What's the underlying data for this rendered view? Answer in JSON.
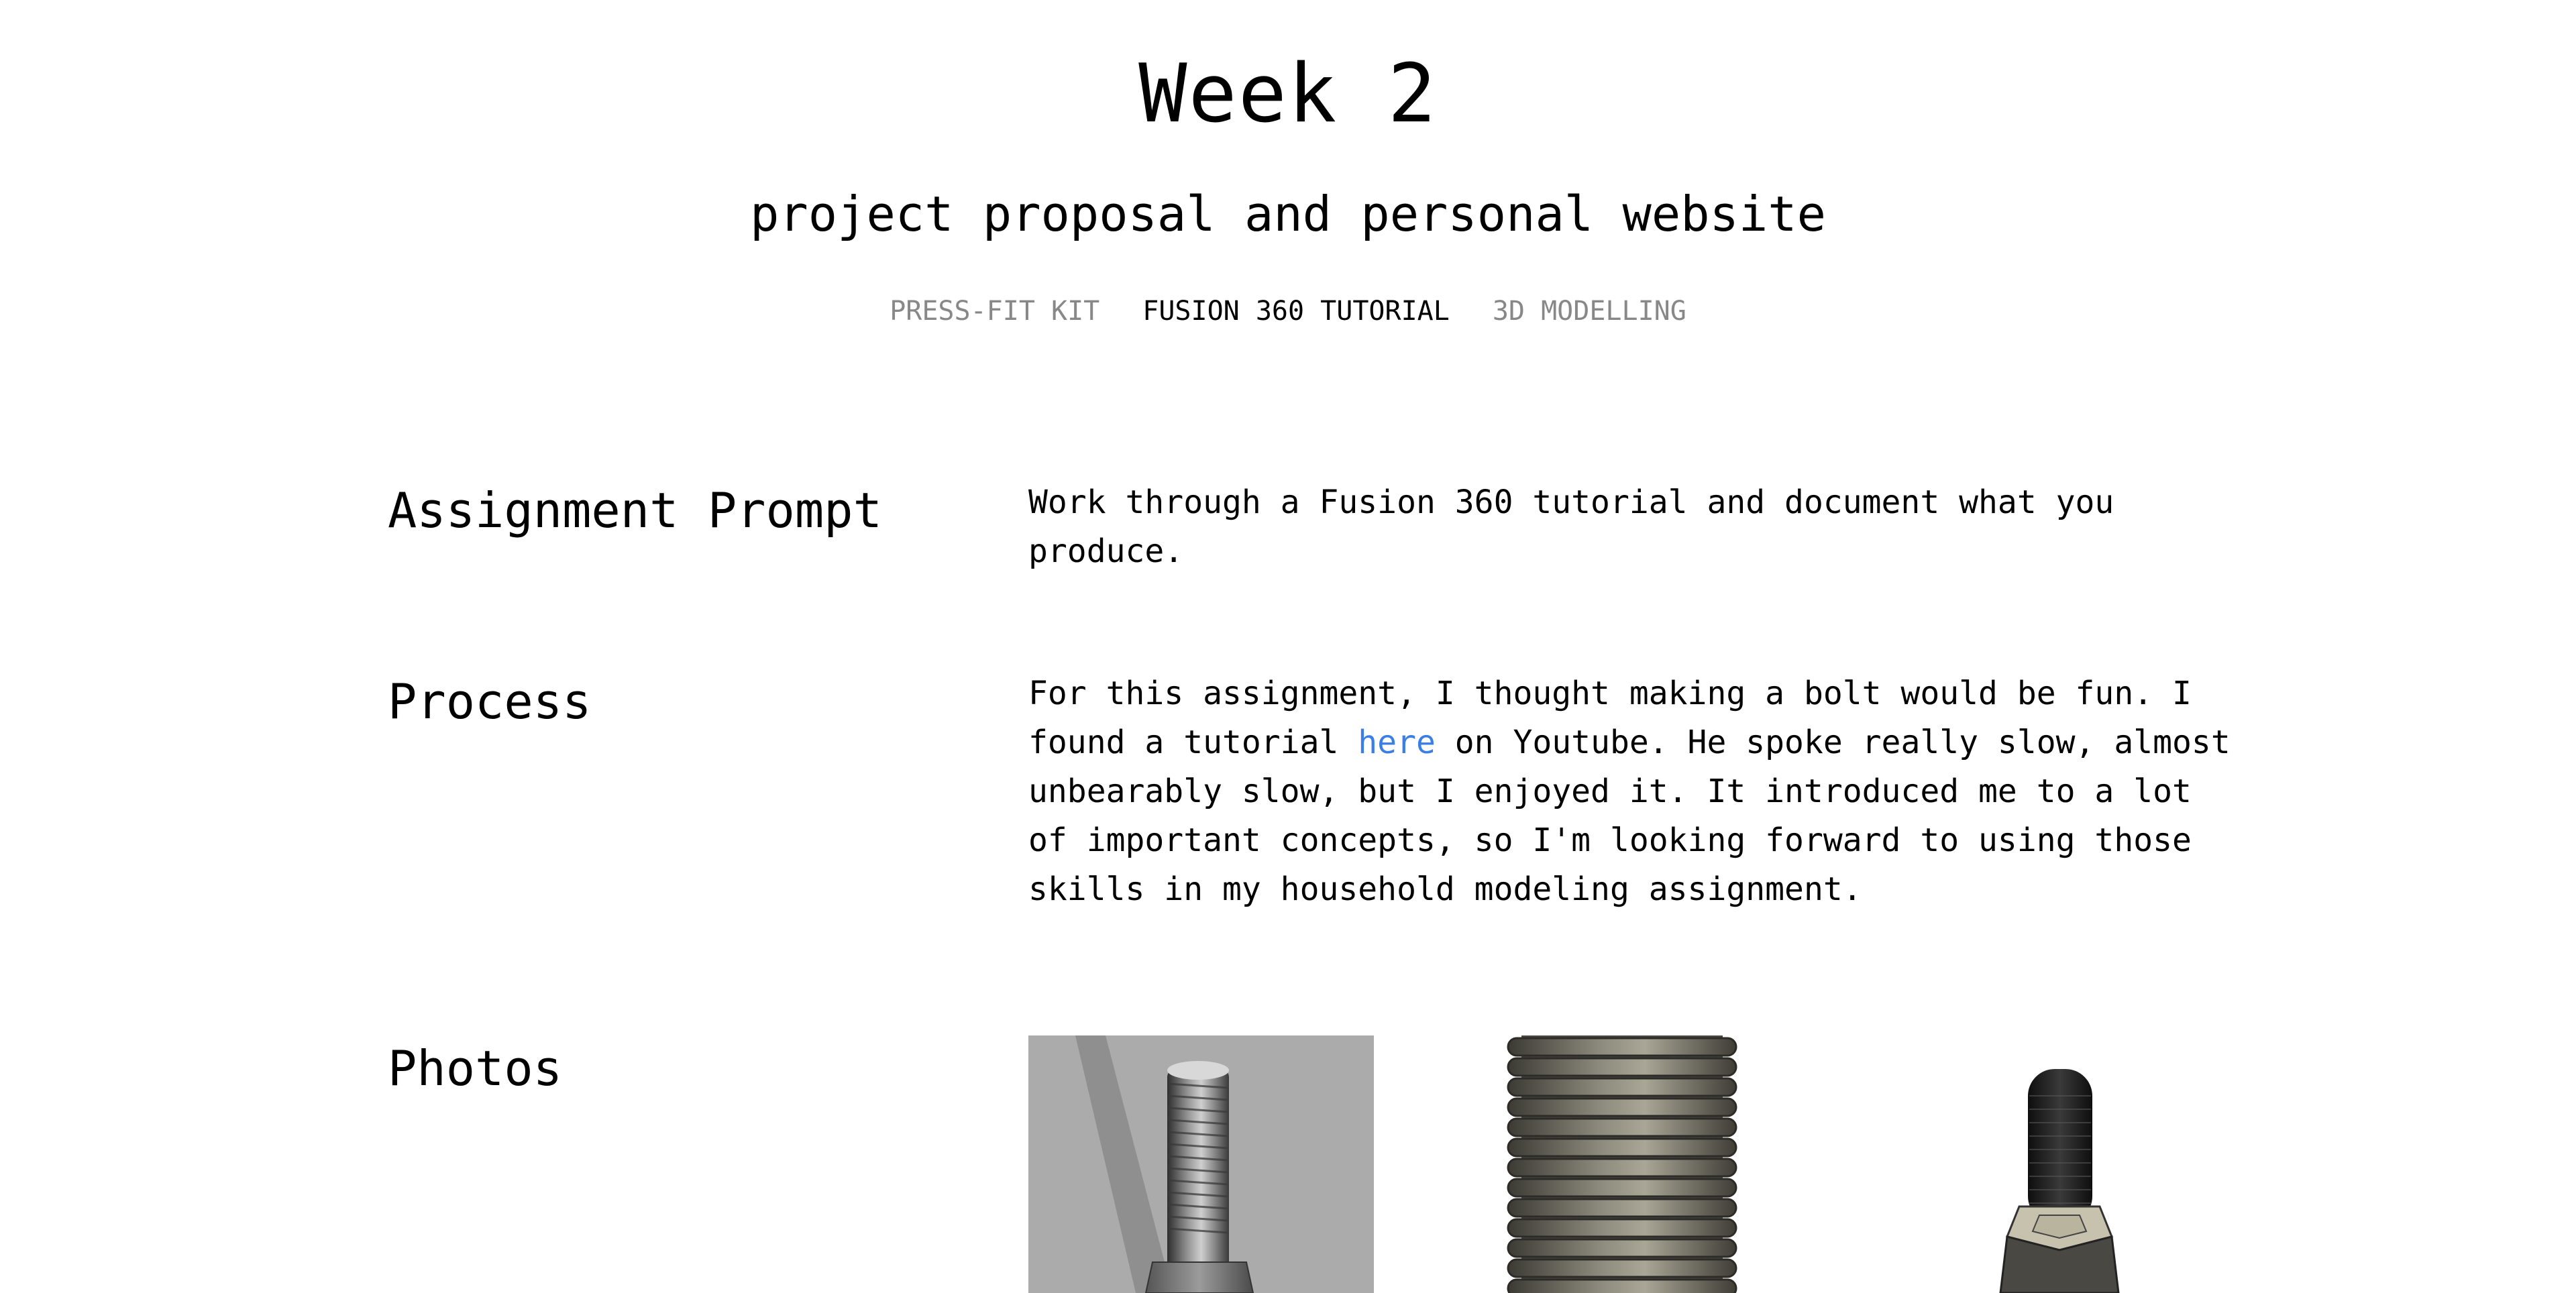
{
  "header": {
    "title": "Week 2",
    "subtitle": "project proposal and personal website"
  },
  "nav": {
    "tabs": [
      {
        "label": "PRESS-FIT KIT",
        "active": false
      },
      {
        "label": "FUSION 360 TUTORIAL",
        "active": true
      },
      {
        "label": "3D MODELLING",
        "active": false
      }
    ]
  },
  "sections": {
    "assignment": {
      "heading": "Assignment Prompt",
      "text": "Work through a Fusion 360 tutorial and document what you produce."
    },
    "process": {
      "heading": "Process",
      "text_before_link": "For this assignment, I thought making a bolt would be fun. I found a tutorial ",
      "link_label": "here",
      "text_after_link": " on Youtube. He spoke really slow, almost unbearably slow, but I enjoyed it. It introduced me to a lot of important concepts, so I'm looking forward to using those skills in my household modeling assignment."
    },
    "photos": {
      "heading": "Photos",
      "items": [
        {
          "name": "bolt-render-shadow"
        },
        {
          "name": "bolt-thread-closeup"
        },
        {
          "name": "bolt-hex-head"
        }
      ]
    }
  },
  "colors": {
    "link": "#3b7ee6",
    "inactive_tab": "#888888",
    "photo_background": "#aaaaaa"
  }
}
